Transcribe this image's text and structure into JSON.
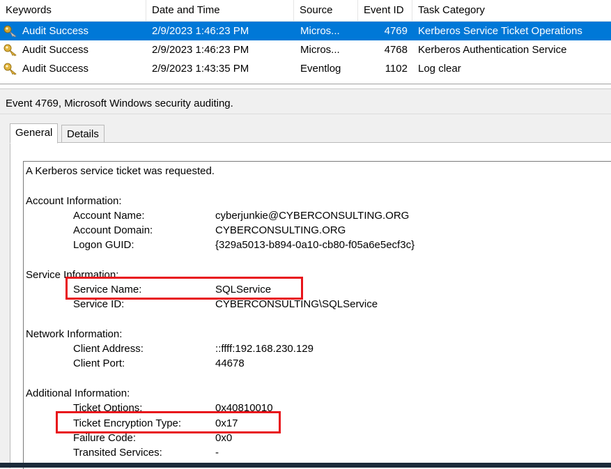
{
  "list": {
    "columns": [
      "Keywords",
      "Date and Time",
      "Source",
      "Event ID",
      "Task Category"
    ],
    "rows": [
      {
        "keywords": "Audit Success",
        "datetime": "2/9/2023 1:46:23 PM",
        "source": "Micros...",
        "event_id": "4769",
        "task_category": "Kerberos Service Ticket Operations",
        "selected": true
      },
      {
        "keywords": "Audit Success",
        "datetime": "2/9/2023 1:46:23 PM",
        "source": "Micros...",
        "event_id": "4768",
        "task_category": "Kerberos Authentication Service",
        "selected": false
      },
      {
        "keywords": "Audit Success",
        "datetime": "2/9/2023 1:43:35 PM",
        "source": "Eventlog",
        "event_id": "1102",
        "task_category": "Log clear",
        "selected": false
      }
    ],
    "row_icon": "key-icon",
    "selection_color": "#0078d7"
  },
  "detail": {
    "title": "Event 4769, Microsoft Windows security auditing.",
    "tabs": [
      "General",
      "Details"
    ],
    "active_tab": "General",
    "intro": "A Kerberos service ticket was requested.",
    "sections": {
      "account": {
        "heading": "Account Information:",
        "fields": [
          {
            "label": "Account Name:",
            "value": "cyberjunkie@CYBERCONSULTING.ORG"
          },
          {
            "label": "Account Domain:",
            "value": "CYBERCONSULTING.ORG"
          },
          {
            "label": "Logon GUID:",
            "value": "{329a5013-b894-0a10-cb80-f05a6e5ecf3c}"
          }
        ]
      },
      "service": {
        "heading": "Service Information:",
        "fields": [
          {
            "label": "Service Name:",
            "value": "SQLService"
          },
          {
            "label": "Service ID:",
            "value": "CYBERCONSULTING\\SQLService"
          }
        ]
      },
      "network": {
        "heading": "Network Information:",
        "fields": [
          {
            "label": "Client Address:",
            "value": "::ffff:192.168.230.129"
          },
          {
            "label": "Client Port:",
            "value": "44678"
          }
        ]
      },
      "additional": {
        "heading": "Additional Information:",
        "fields": [
          {
            "label": "Ticket Options:",
            "value": "0x40810010"
          },
          {
            "label": "Ticket Encryption Type:",
            "value": "0x17"
          },
          {
            "label": "Failure Code:",
            "value": "0x0"
          },
          {
            "label": "Transited Services:",
            "value": "-"
          }
        ]
      }
    },
    "highlight_color": "#e8141b"
  }
}
